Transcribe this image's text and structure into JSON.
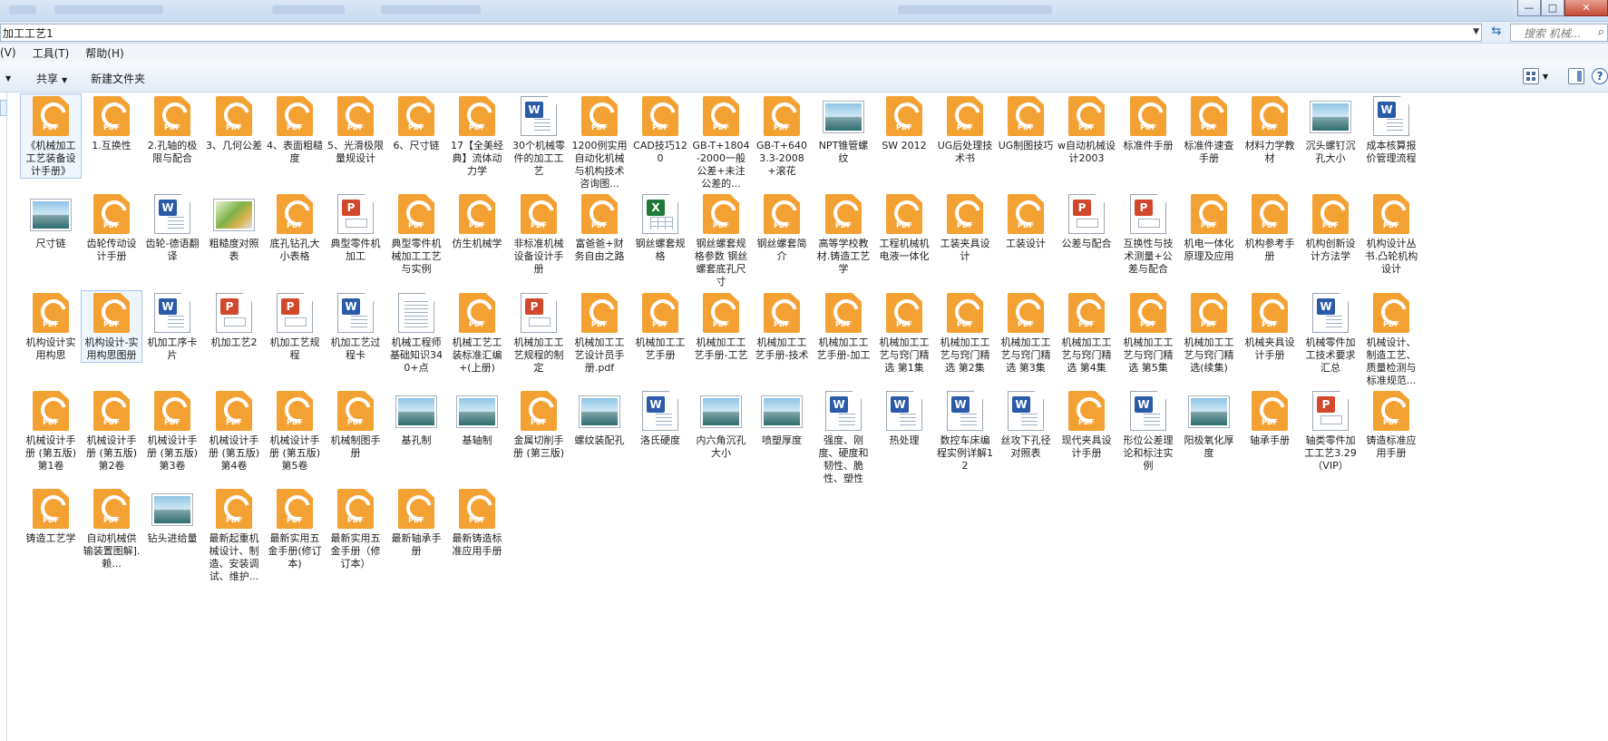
{
  "window": {
    "address": "加工工艺1",
    "search_placeholder": "搜索 机械...",
    "min_label": "—",
    "max_label": "□",
    "close_label": "✕"
  },
  "menu": [
    "(V)",
    "工具(T)",
    "帮助(H)"
  ],
  "toolbar": {
    "share_label": "共享",
    "new_folder_label": "新建文件夹"
  },
  "files": [
    {
      "type": "pdf",
      "name": "《机械加工工艺装备设计手册》"
    },
    {
      "type": "pdf",
      "name": "1.互换性"
    },
    {
      "type": "pdf",
      "name": "2.孔轴的极限与配合"
    },
    {
      "type": "pdf",
      "name": "3、几何公差"
    },
    {
      "type": "pdf",
      "name": "4、表面粗糙度"
    },
    {
      "type": "pdf",
      "name": "5、光滑极限量规设计"
    },
    {
      "type": "pdf",
      "name": "6、尺寸链"
    },
    {
      "type": "pdf",
      "name": "17【全美经典】流体动力学"
    },
    {
      "type": "word",
      "name": "30个机械零件的加工工艺"
    },
    {
      "type": "pdf",
      "name": "1200例实用自动化机械与机构技术咨询图..."
    },
    {
      "type": "pdf",
      "name": "CAD技巧120"
    },
    {
      "type": "pdf",
      "name": "GB-T+1804-2000一般公差+未注公差的..."
    },
    {
      "type": "pdf",
      "name": "GB-T+6403.3-2008+滚花"
    },
    {
      "type": "img",
      "name": "NPT锥管螺纹"
    },
    {
      "type": "pdf",
      "name": "SW 2012"
    },
    {
      "type": "pdf",
      "name": "UG后处理技术书"
    },
    {
      "type": "pdf",
      "name": "UG制图技巧"
    },
    {
      "type": "pdf",
      "name": "w自动机械设计2003"
    },
    {
      "type": "pdf",
      "name": "标准件手册"
    },
    {
      "type": "pdf",
      "name": "标准件速查手册"
    },
    {
      "type": "pdf",
      "name": "材料力学教材"
    },
    {
      "type": "img",
      "name": "沉头螺钉沉孔大小"
    },
    {
      "type": "word",
      "name": "成本核算报价管理流程"
    },
    {
      "type": "img",
      "name": "尺寸链"
    },
    {
      "type": "pdf",
      "name": "齿轮传动设计手册"
    },
    {
      "type": "word",
      "name": "齿轮-德语翻译"
    },
    {
      "type": "pic",
      "name": "粗糙度对照表"
    },
    {
      "type": "pdf",
      "name": "底孔钻孔大小表格"
    },
    {
      "type": "ppt",
      "name": "典型零件机加工"
    },
    {
      "type": "pdf",
      "name": "典型零件机械加工工艺与实例"
    },
    {
      "type": "pdf",
      "name": "仿生机械学"
    },
    {
      "type": "pdf",
      "name": "非标准机械设备设计手册"
    },
    {
      "type": "pdf",
      "name": "富爸爸+财务自由之路"
    },
    {
      "type": "xls",
      "name": "钢丝螺套规格"
    },
    {
      "type": "pdf",
      "name": "钢丝螺套规格参数 钢丝螺套底孔尺寸"
    },
    {
      "type": "pdf",
      "name": "钢丝螺套简介"
    },
    {
      "type": "pdf",
      "name": "高等学校教材.铸造工艺学"
    },
    {
      "type": "pdf",
      "name": "工程机械机电液一体化"
    },
    {
      "type": "pdf",
      "name": "工装夹具设计"
    },
    {
      "type": "pdf",
      "name": "工装设计"
    },
    {
      "type": "ppt",
      "name": "公差与配合"
    },
    {
      "type": "ppt",
      "name": "互换性与技术测量+公差与配合"
    },
    {
      "type": "pdf",
      "name": "机电一体化原理及应用"
    },
    {
      "type": "pdf",
      "name": "机构参考手册"
    },
    {
      "type": "pdf",
      "name": "机构创新设计方法学"
    },
    {
      "type": "pdf",
      "name": "机构设计丛书.凸轮机构设计"
    },
    {
      "type": "pdf",
      "name": "机构设计实用构思"
    },
    {
      "type": "pdf",
      "name": "机构设计-实用构思图册"
    },
    {
      "type": "word",
      "name": "机加工序卡片"
    },
    {
      "type": "ppt",
      "name": "机加工艺2"
    },
    {
      "type": "ppt",
      "name": "机加工艺规程"
    },
    {
      "type": "word",
      "name": "机加工艺过程卡"
    },
    {
      "type": "txt",
      "name": "机械工程师基础知识340+点"
    },
    {
      "type": "pdf",
      "name": "机械工艺工装标准汇编+(上册)"
    },
    {
      "type": "ppt",
      "name": "机械加工工艺规程的制定"
    },
    {
      "type": "pdf",
      "name": "机械加工工艺设计员手册.pdf"
    },
    {
      "type": "pdf",
      "name": "机械加工工艺手册"
    },
    {
      "type": "pdf",
      "name": "机械加工工艺手册-工艺"
    },
    {
      "type": "pdf",
      "name": "机械加工工艺手册-技术"
    },
    {
      "type": "pdf",
      "name": "机械加工工艺手册-加工"
    },
    {
      "type": "pdf",
      "name": "机械加工工艺与窍门精选 第1集"
    },
    {
      "type": "pdf",
      "name": "机械加工工艺与窍门精选 第2集"
    },
    {
      "type": "pdf",
      "name": "机械加工工艺与窍门精选 第3集"
    },
    {
      "type": "pdf",
      "name": "机械加工工艺与窍门精选 第4集"
    },
    {
      "type": "pdf",
      "name": "机械加工工艺与窍门精选 第5集"
    },
    {
      "type": "pdf",
      "name": "机械加工工艺与窍门精选(续集)"
    },
    {
      "type": "pdf",
      "name": "机械夹具设计手册"
    },
    {
      "type": "word",
      "name": "机械零件加工技术要求汇总"
    },
    {
      "type": "pdf",
      "name": "机械设计、制造工艺、质量检测与标准规范..."
    },
    {
      "type": "pdf",
      "name": "机械设计手册 (第五版) 第1卷"
    },
    {
      "type": "pdf",
      "name": "机械设计手册 (第五版) 第2卷"
    },
    {
      "type": "pdf",
      "name": "机械设计手册 (第五版) 第3卷"
    },
    {
      "type": "pdf",
      "name": "机械设计手册 (第五版) 第4卷"
    },
    {
      "type": "pdf",
      "name": "机械设计手册 (第五版) 第5卷"
    },
    {
      "type": "pdf",
      "name": "机械制图手册"
    },
    {
      "type": "img",
      "name": "基孔制"
    },
    {
      "type": "img",
      "name": "基轴制"
    },
    {
      "type": "pdf",
      "name": "金属切削手册 (第三版)"
    },
    {
      "type": "img",
      "name": "螺纹装配孔"
    },
    {
      "type": "word",
      "name": "洛氏硬度"
    },
    {
      "type": "img",
      "name": "内六角沉孔大小"
    },
    {
      "type": "img",
      "name": "喷塑厚度"
    },
    {
      "type": "word",
      "name": "强度、刚度、硬度和韧性、脆性、塑性"
    },
    {
      "type": "word",
      "name": "热处理"
    },
    {
      "type": "word",
      "name": "数控车床编程实例详解12"
    },
    {
      "type": "word",
      "name": "丝攻下孔径对照表"
    },
    {
      "type": "pdf",
      "name": "现代夹具设计手册"
    },
    {
      "type": "word",
      "name": "形位公差理论和标注实例"
    },
    {
      "type": "img",
      "name": "阳极氧化厚度"
    },
    {
      "type": "pdf",
      "name": "轴承手册"
    },
    {
      "type": "ppt",
      "name": "轴类零件加工工艺3.29（VIP）"
    },
    {
      "type": "pdf",
      "name": "铸造标准应用手册"
    },
    {
      "type": "pdf",
      "name": "铸造工艺学"
    },
    {
      "type": "pdf",
      "name": "自动机械供输装置图解].赖..."
    },
    {
      "type": "img",
      "name": "钻头进给量"
    },
    {
      "type": "pdf",
      "name": "最新起重机械设计、制造、安装调试、维护..."
    },
    {
      "type": "pdf",
      "name": "最新实用五金手册(修订本)"
    },
    {
      "type": "pdf",
      "name": "最新实用五金手册（修订本）"
    },
    {
      "type": "pdf",
      "name": "最新轴承手册"
    },
    {
      "type": "pdf",
      "name": "最新铸造标准应用手册"
    }
  ]
}
